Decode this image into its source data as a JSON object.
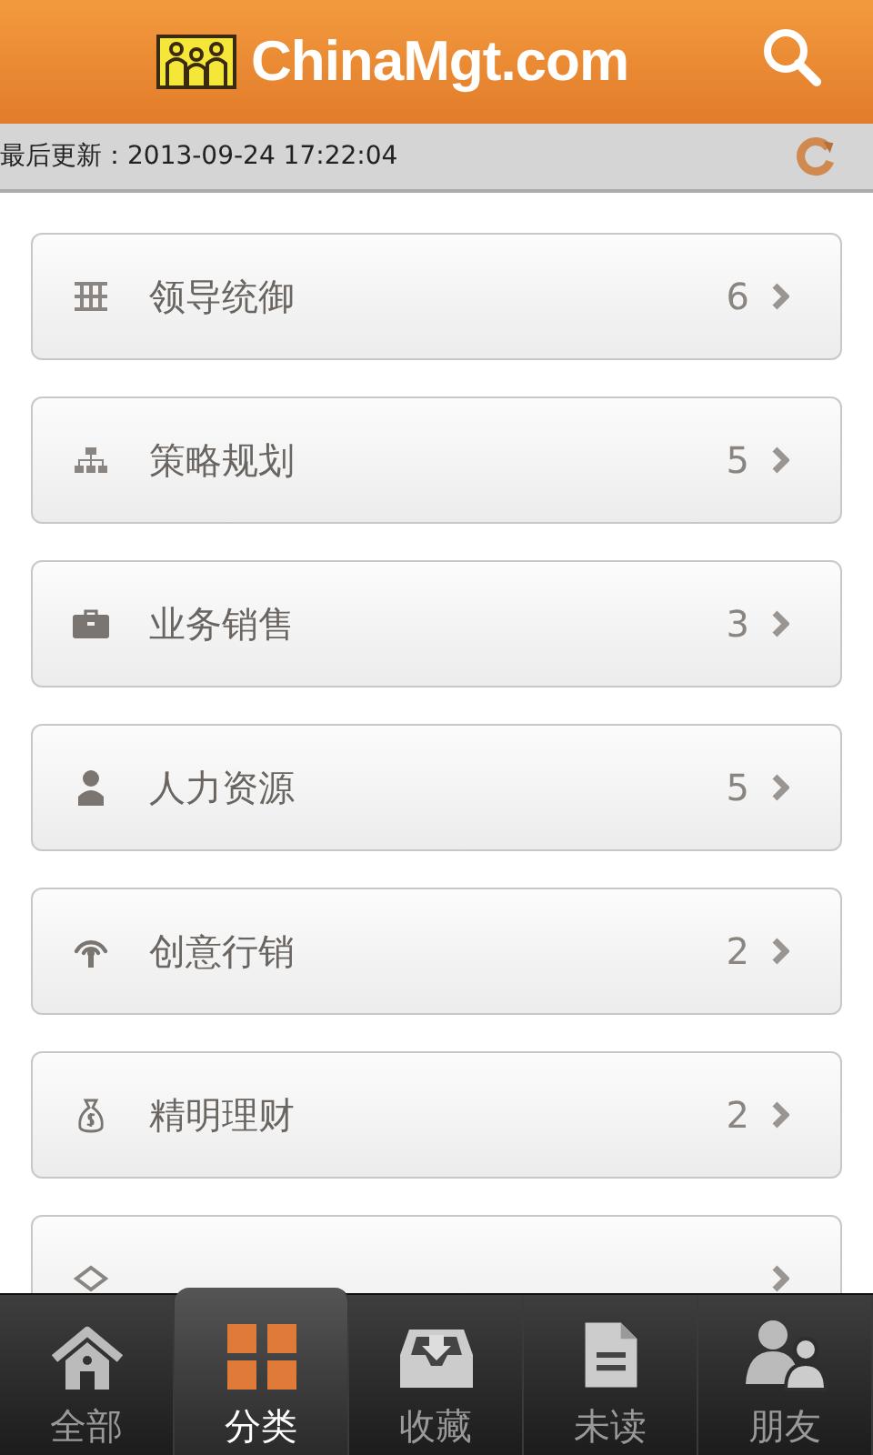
{
  "header": {
    "logo_text": "ChinaMgt.com"
  },
  "update_bar": {
    "text": "最后更新：2013-09-24 17:22:04"
  },
  "categories": [
    {
      "kind": "grid",
      "label": "领导统御",
      "count": "6"
    },
    {
      "kind": "org",
      "label": "策略规划",
      "count": "5"
    },
    {
      "kind": "briefcase",
      "label": "业务销售",
      "count": "3"
    },
    {
      "kind": "person",
      "label": "人力资源",
      "count": "5"
    },
    {
      "kind": "antenna",
      "label": "创意行销",
      "count": "2"
    },
    {
      "kind": "moneybag",
      "label": "精明理财",
      "count": "2"
    },
    {
      "kind": "diamond"
    }
  ],
  "tabs": [
    {
      "kind": "home",
      "label": "全部",
      "selected": false
    },
    {
      "kind": "squares",
      "label": "分类",
      "selected": true
    },
    {
      "kind": "inbox",
      "label": "收藏",
      "selected": false
    },
    {
      "kind": "document",
      "label": "未读",
      "selected": false
    },
    {
      "kind": "people",
      "label": "朋友",
      "selected": false
    }
  ]
}
